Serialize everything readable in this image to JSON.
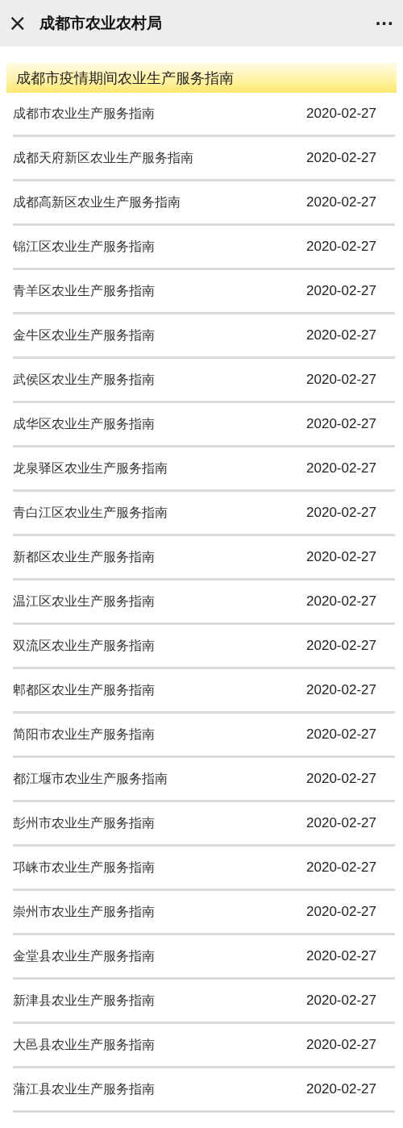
{
  "header": {
    "title": "成都市农业农村局",
    "close_icon": "×",
    "more_icon": "···"
  },
  "banner": {
    "title": "成都市疫情期间农业生产服务指南"
  },
  "items": [
    {
      "title": "成都市农业生产服务指南",
      "date": "2020-02-27"
    },
    {
      "title": "成都天府新区农业生产服务指南",
      "date": "2020-02-27"
    },
    {
      "title": "成都高新区农业生产服务指南",
      "date": "2020-02-27"
    },
    {
      "title": "锦江区农业生产服务指南",
      "date": "2020-02-27"
    },
    {
      "title": "青羊区农业生产服务指南",
      "date": "2020-02-27"
    },
    {
      "title": "金牛区农业生产服务指南",
      "date": "2020-02-27"
    },
    {
      "title": "武侯区农业生产服务指南",
      "date": "2020-02-27"
    },
    {
      "title": "成华区农业生产服务指南",
      "date": "2020-02-27"
    },
    {
      "title": "龙泉驿区农业生产服务指南",
      "date": "2020-02-27"
    },
    {
      "title": "青白江区农业生产服务指南",
      "date": "2020-02-27"
    },
    {
      "title": "新都区农业生产服务指南",
      "date": "2020-02-27"
    },
    {
      "title": "温江区农业生产服务指南",
      "date": "2020-02-27"
    },
    {
      "title": "双流区农业生产服务指南",
      "date": "2020-02-27"
    },
    {
      "title": "郫都区农业生产服务指南",
      "date": "2020-02-27"
    },
    {
      "title": "简阳市农业生产服务指南",
      "date": "2020-02-27"
    },
    {
      "title": "都江堰市农业生产服务指南",
      "date": "2020-02-27"
    },
    {
      "title": "彭州市农业生产服务指南",
      "date": "2020-02-27"
    },
    {
      "title": "邛崃市农业生产服务指南",
      "date": "2020-02-27"
    },
    {
      "title": "崇州市农业生产服务指南",
      "date": "2020-02-27"
    },
    {
      "title": "金堂县农业生产服务指南",
      "date": "2020-02-27"
    },
    {
      "title": "新津县农业生产服务指南",
      "date": "2020-02-27"
    },
    {
      "title": "大邑县农业生产服务指南",
      "date": "2020-02-27"
    },
    {
      "title": "蒲江县农业生产服务指南",
      "date": "2020-02-27"
    }
  ]
}
